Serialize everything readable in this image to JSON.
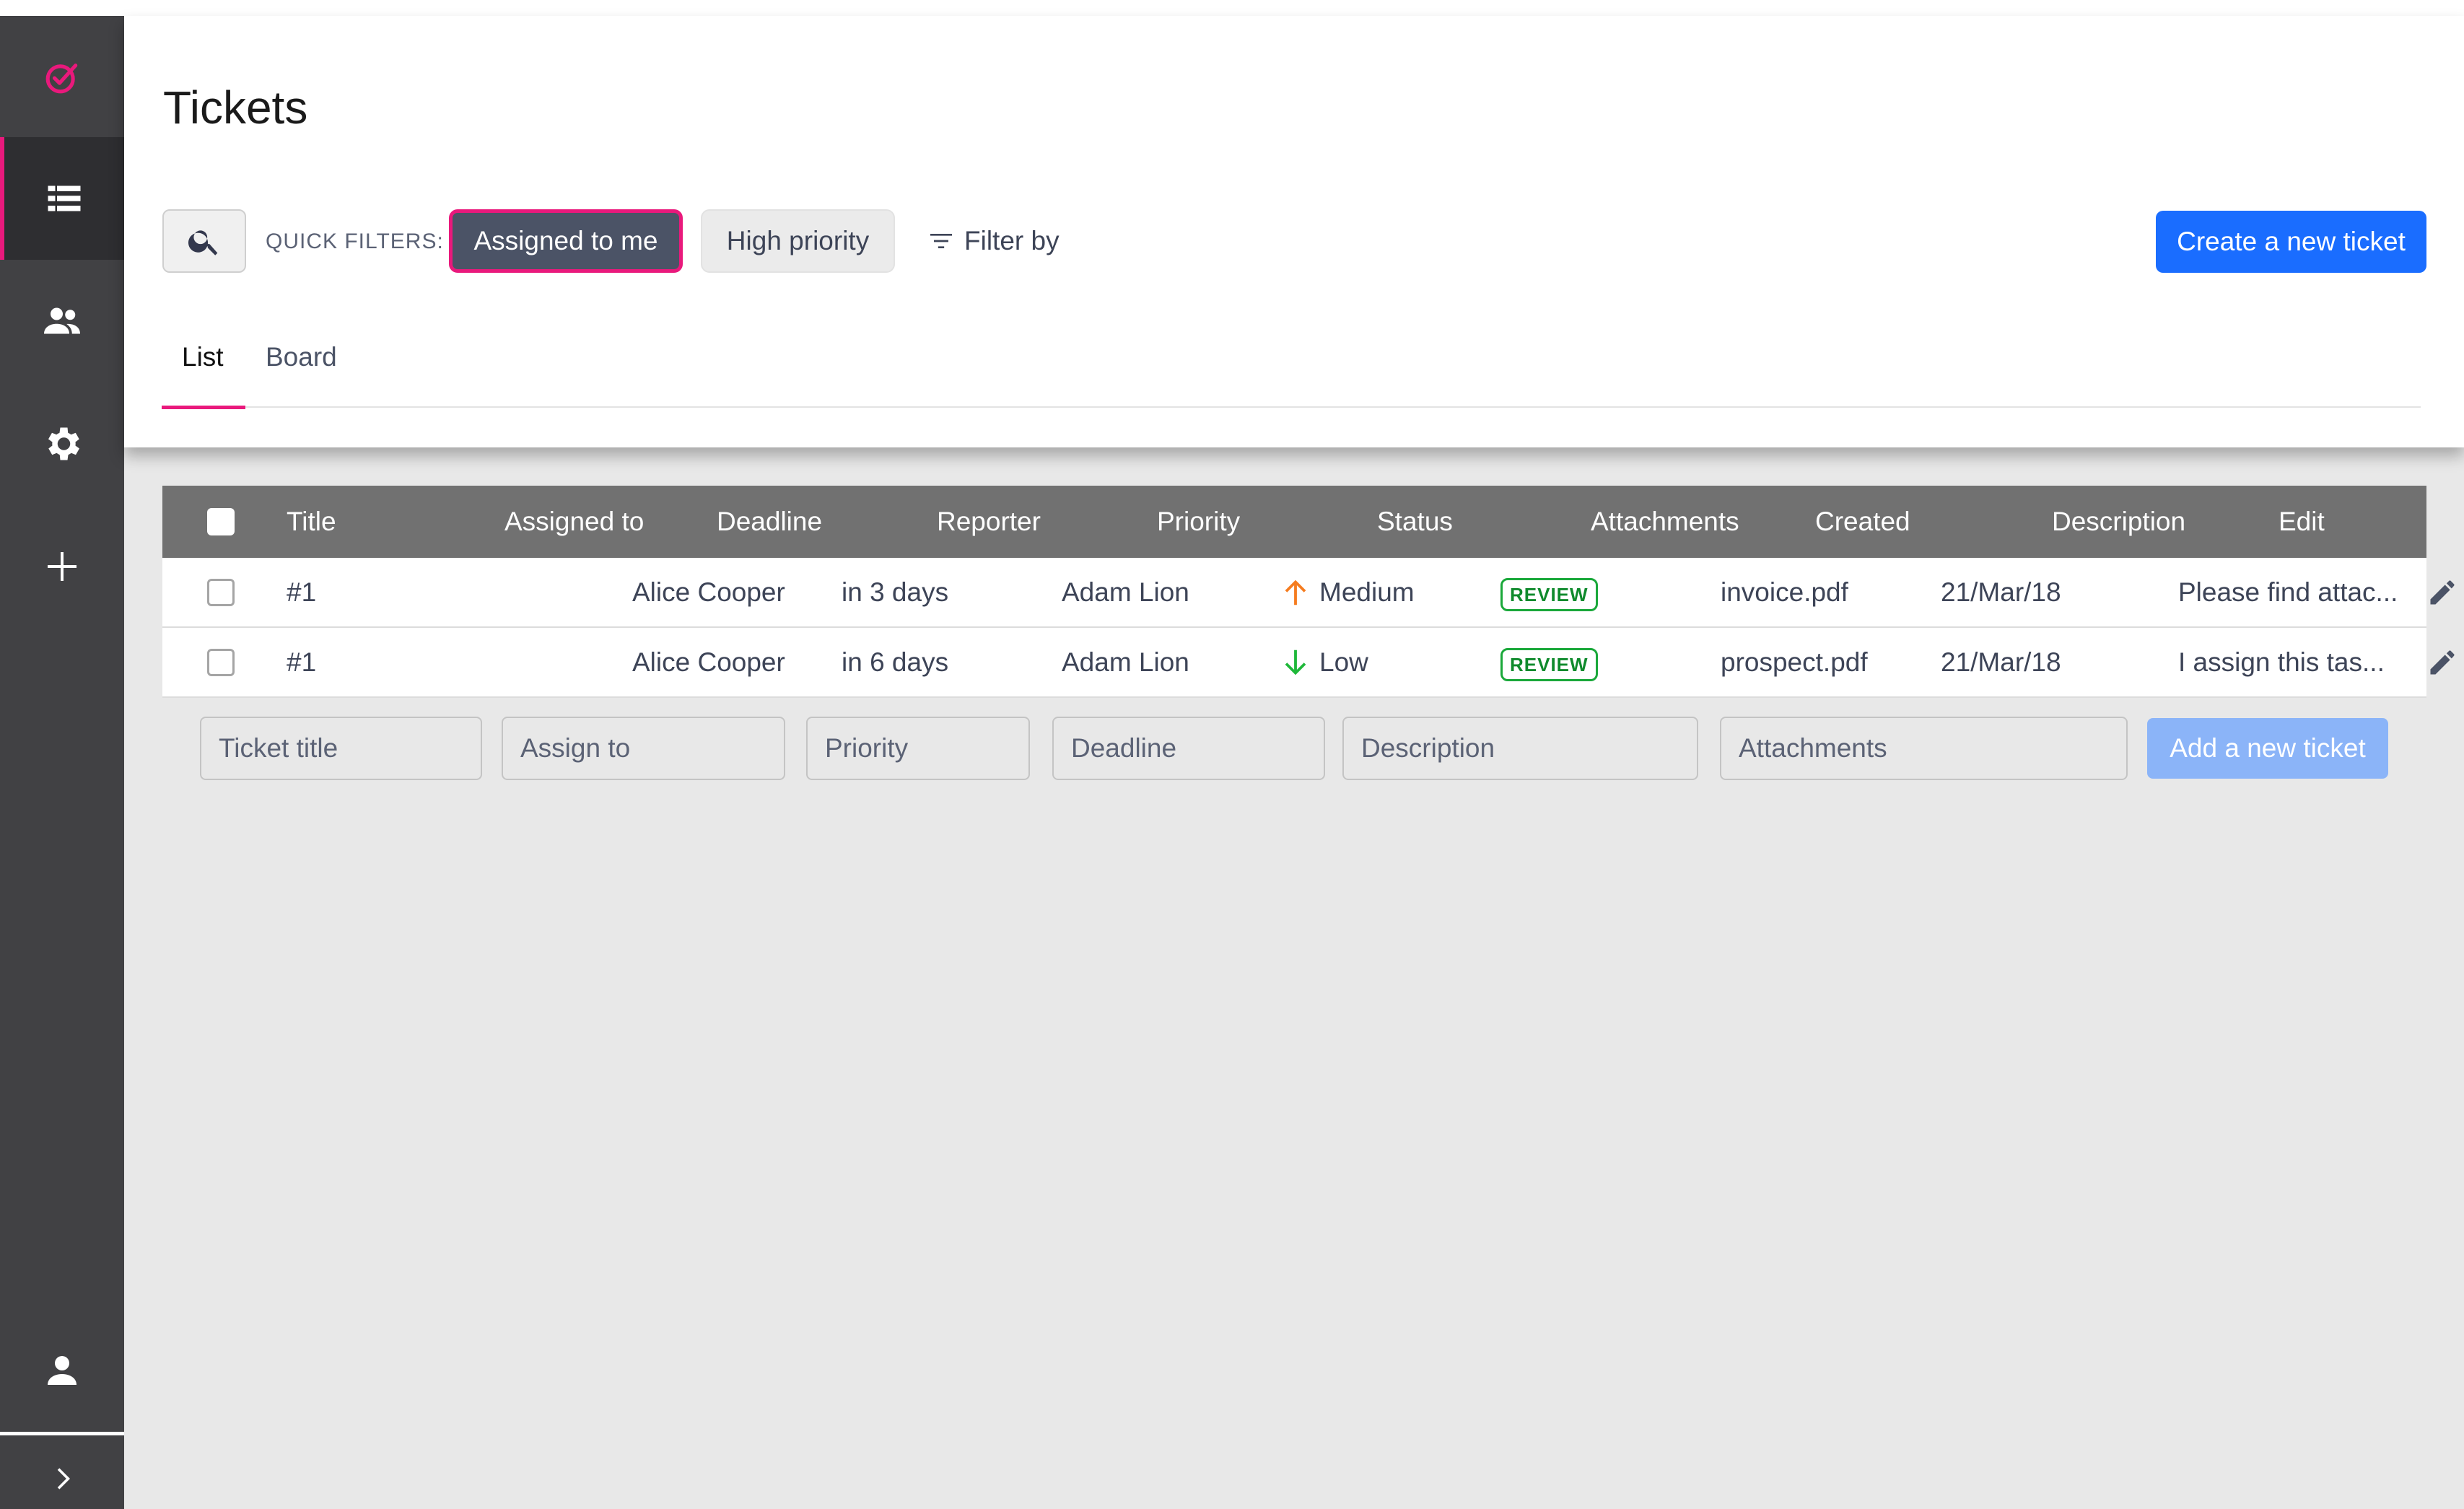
{
  "sidebar": {
    "items": [
      {
        "icon": "check-circle-icon",
        "active": false
      },
      {
        "icon": "list-icon",
        "active": true
      },
      {
        "icon": "people-icon",
        "active": false
      },
      {
        "icon": "gear-icon",
        "active": false
      },
      {
        "icon": "plus-icon",
        "active": false
      },
      {
        "icon": "user-icon",
        "active": false
      },
      {
        "icon": "chevron-right-icon",
        "active": false
      }
    ]
  },
  "header": {
    "title": "Tickets",
    "quick_filters_label": "QUICK FILTERS:",
    "filters": [
      "Assigned to me",
      "High priority"
    ],
    "filter_by": "Filter by",
    "create_button": "Create a new ticket"
  },
  "tabs": [
    "List",
    "Board"
  ],
  "table": {
    "columns": [
      "Title",
      "Assigned to",
      "Deadline",
      "Reporter",
      "Priority",
      "Status",
      "Attachments",
      "Created",
      "Description",
      "Edit"
    ],
    "rows": [
      {
        "title": "#1",
        "assigned_to": "Alice Cooper",
        "deadline": "in 3 days",
        "reporter": "Adam Lion",
        "priority": "Medium",
        "status": "REVIEW",
        "attachment": "invoice.pdf",
        "created": "21/Mar/18",
        "description": "Please find attac..."
      },
      {
        "title": "#1",
        "assigned_to": "Alice Cooper",
        "deadline": "in 6 days",
        "reporter": "Adam Lion",
        "priority": "Low",
        "status": "REVIEW",
        "attachment": "prospect.pdf",
        "created": "21/Mar/18",
        "description": "I assign this tas..."
      }
    ]
  },
  "add_row": {
    "ticket_title": "Ticket title",
    "assign_to": "Assign to",
    "priority": "Priority",
    "deadline": "Deadline",
    "description": "Description",
    "attachments": "Attachments",
    "button": "Add a new ticket"
  },
  "colors": {
    "accent": "#e9197c",
    "primary": "#1a6dff",
    "sidebar": "#414144",
    "priority_medium": "#f57c1f",
    "priority_low": "#1fb83a",
    "status_review": "#1aa83a"
  }
}
